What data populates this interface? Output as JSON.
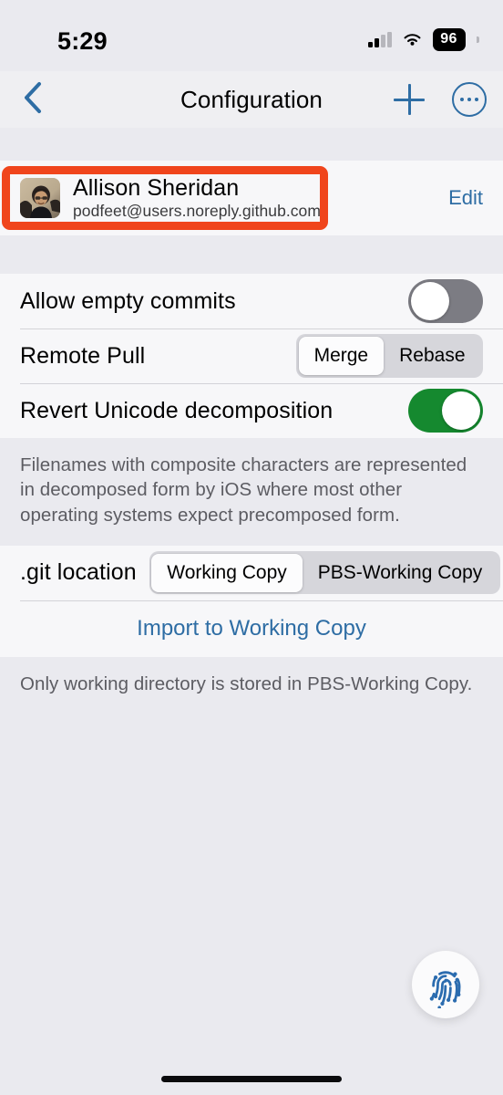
{
  "status_bar": {
    "time": "5:29",
    "battery_percent": "96",
    "cellular_icon": "cellular-signal-icon",
    "wifi_icon": "wifi-icon",
    "battery_icon": "battery-icon"
  },
  "nav": {
    "title": "Configuration",
    "back_icon": "chevron-left-icon",
    "add_icon": "plus-icon",
    "more_icon": "ellipsis-circle-icon"
  },
  "account": {
    "name": "Allison Sheridan",
    "email": "podfeet@users.noreply.github.com",
    "edit_label": "Edit",
    "avatar_icon": "user-avatar-photo",
    "highlight_color": "#F0451C"
  },
  "settings": {
    "allow_empty_commits": {
      "label": "Allow empty commits",
      "state": "off"
    },
    "remote_pull": {
      "label": "Remote Pull",
      "options": [
        "Merge",
        "Rebase"
      ],
      "selected": "Merge"
    },
    "revert_unicode": {
      "label": "Revert Unicode decomposition",
      "state": "on"
    },
    "unicode_footnote": "Filenames with composite characters are represented in decomposed form by iOS where most other operating systems expect precomposed form."
  },
  "git_location": {
    "label": ".git location",
    "options": [
      "Working Copy",
      "PBS-Working Copy"
    ],
    "selected": "Working Copy",
    "import_label": "Import to Working Copy",
    "footnote": "Only working directory is stored in PBS-Working Copy."
  },
  "fab": {
    "icon": "fingerprint-icon",
    "color": "#2E6DA4"
  },
  "colors": {
    "accent_blue": "#2E6DA4",
    "toggle_on_green": "#15892F",
    "toggle_off_gray": "#7C7C83",
    "page_background": "#EAEAEF",
    "group_background": "#F7F7F9"
  }
}
